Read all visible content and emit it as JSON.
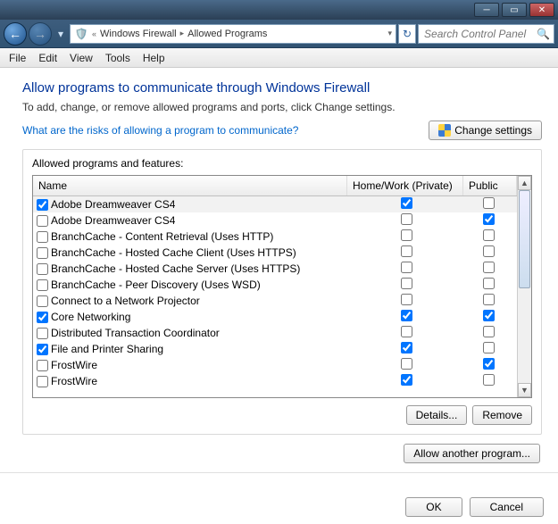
{
  "breadcrumb": {
    "seg1": "Windows Firewall",
    "seg2": "Allowed Programs"
  },
  "search": {
    "placeholder": "Search Control Panel"
  },
  "menu": {
    "file": "File",
    "edit": "Edit",
    "view": "View",
    "tools": "Tools",
    "help": "Help"
  },
  "main": {
    "title": "Allow programs to communicate through Windows Firewall",
    "desc": "To add, change, or remove allowed programs and ports, click Change settings.",
    "risk_link": "What are the risks of allowing a program to communicate?",
    "change_settings": "Change settings",
    "panel_label": "Allowed programs and features:",
    "col_name": "Name",
    "col_hw": "Home/Work (Private)",
    "col_pub": "Public",
    "details": "Details...",
    "remove": "Remove",
    "allow_another": "Allow another program...",
    "ok": "OK",
    "cancel": "Cancel"
  },
  "rows": [
    {
      "name": "Adobe Dreamweaver CS4",
      "enabled": true,
      "hw": true,
      "pub": false,
      "selected": true
    },
    {
      "name": "Adobe Dreamweaver CS4",
      "enabled": false,
      "hw": false,
      "pub": true
    },
    {
      "name": "BranchCache - Content Retrieval (Uses HTTP)",
      "enabled": false,
      "hw": false,
      "pub": false
    },
    {
      "name": "BranchCache - Hosted Cache Client (Uses HTTPS)",
      "enabled": false,
      "hw": false,
      "pub": false
    },
    {
      "name": "BranchCache - Hosted Cache Server (Uses HTTPS)",
      "enabled": false,
      "hw": false,
      "pub": false
    },
    {
      "name": "BranchCache - Peer Discovery (Uses WSD)",
      "enabled": false,
      "hw": false,
      "pub": false
    },
    {
      "name": "Connect to a Network Projector",
      "enabled": false,
      "hw": false,
      "pub": false
    },
    {
      "name": "Core Networking",
      "enabled": true,
      "hw": true,
      "pub": true
    },
    {
      "name": "Distributed Transaction Coordinator",
      "enabled": false,
      "hw": false,
      "pub": false
    },
    {
      "name": "File and Printer Sharing",
      "enabled": true,
      "hw": true,
      "pub": false
    },
    {
      "name": "FrostWire",
      "enabled": false,
      "hw": false,
      "pub": true
    },
    {
      "name": "FrostWire",
      "enabled": false,
      "hw": true,
      "pub": false
    }
  ]
}
